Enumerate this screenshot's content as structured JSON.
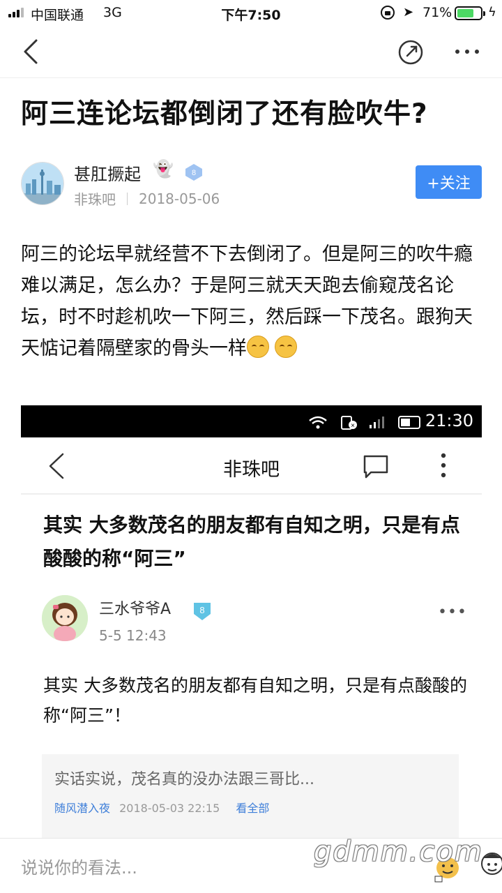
{
  "status_bar": {
    "carrier": "中国联通",
    "network": "3G",
    "time": "下午7:50",
    "battery_percent": "71%",
    "battery_level": 0.71
  },
  "post": {
    "title": "阿三连论坛都倒闭了还有脸吹牛?",
    "author": {
      "name": "甚肛撅起",
      "emoji": "👻",
      "level": "8",
      "forum": "非珠吧",
      "date": "2018-05-06"
    },
    "follow_label": "+关注",
    "body": "阿三的论坛早就经营不下去倒闭了。但是阿三的吹牛瘾难以满足，怎么办？于是阿三就天天跑去偷窥茂名论坛，时不时趁机吹一下阿三，然后踩一下茂名。跟狗天天惦记着隔壁家的骨头一样"
  },
  "embedded_screenshot": {
    "status_time": "21:30",
    "nav_title": "非珠吧",
    "thread_title": "其实 大多数茂名的朋友都有自知之明，只是有点酸酸的称“阿三”",
    "user": {
      "name": "三水爷爷A",
      "level": "8",
      "time": "5-5 12:43"
    },
    "content": "其实 大多数茂名的朋友都有自知之明，只是有点酸酸的称“阿三”！",
    "quote": {
      "text": "实话实说，茂名真的没办法跟三哥比...",
      "user": "随风潜入夜",
      "time": "2018-05-03 22:15",
      "view_all": "看全部"
    }
  },
  "bottom_bar": {
    "comment_placeholder": "说说你的看法..."
  },
  "watermark": "gdmm.com",
  "colors": {
    "accent": "#3f8cf5",
    "battery": "#4cd964",
    "link": "#3f7fd9"
  }
}
